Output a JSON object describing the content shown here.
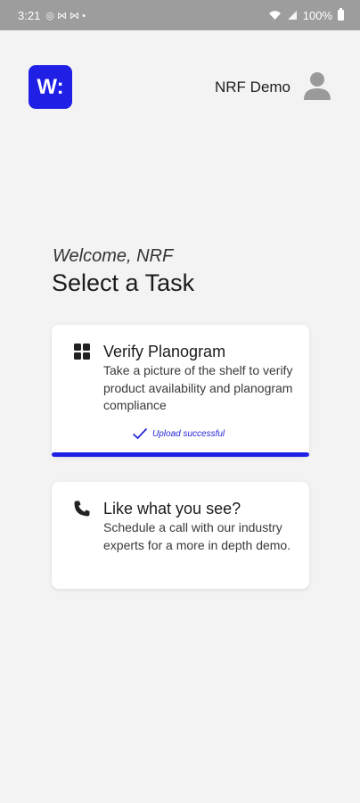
{
  "status_bar": {
    "time": "3:21",
    "notification_icons": "◎ ⋈ ⋈ •",
    "battery_percent": "100%"
  },
  "header": {
    "logo_text": "W:",
    "user_name": "NRF Demo"
  },
  "welcome": {
    "greeting": "Welcome, NRF",
    "title": "Select a Task"
  },
  "tasks": [
    {
      "icon": "grid-icon",
      "title": "Verify Planogram",
      "description": "Take a picture of the shelf to verify product availability and planogram compliance",
      "status": "Upload successful",
      "progress": 1.0
    },
    {
      "icon": "phone-icon",
      "title": "Like what you see?",
      "description": "Schedule a call with our industry experts for a more in depth demo."
    }
  ],
  "colors": {
    "accent": "#1f1fe6",
    "background": "#f3f3f3",
    "status_bar": "#9d9d9d"
  }
}
